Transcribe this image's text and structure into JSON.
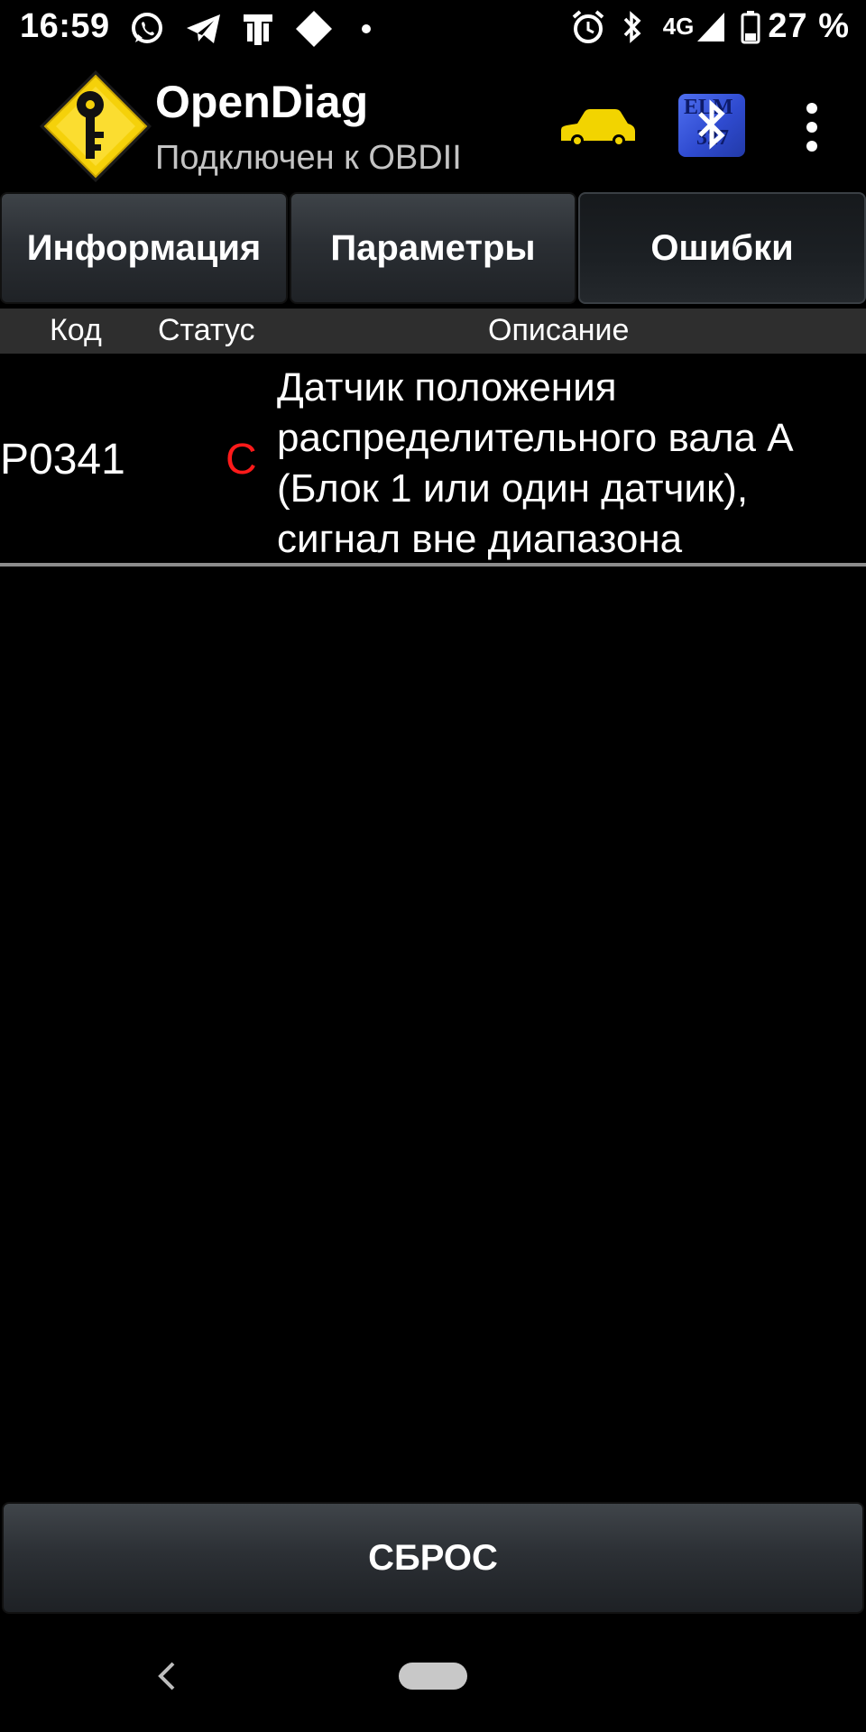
{
  "status_bar": {
    "time": "16:59",
    "network": "4G",
    "battery": "27 %",
    "icons_left": [
      "whatsapp-icon",
      "telegram-icon",
      "game-icon",
      "diamond-icon",
      "dot-icon"
    ],
    "icons_right": [
      "alarm-icon",
      "bluetooth-icon",
      "signal-icon",
      "battery-icon"
    ]
  },
  "app_bar": {
    "title": "OpenDiag",
    "subtitle": "Подключен к OBDII",
    "car_color": "#f2d400",
    "elm_lines": [
      "ELM",
      "327"
    ]
  },
  "tabs": [
    {
      "label": "Информация",
      "active": false
    },
    {
      "label": "Параметры",
      "active": false
    },
    {
      "label": "Ошибки",
      "active": true
    }
  ],
  "table": {
    "headers": {
      "code": "Код",
      "status": "Статус",
      "description": "Описание"
    },
    "rows": [
      {
        "code": "P0341",
        "status": "C",
        "description": "Датчик положения распределительного вала A (Блок 1 или один датчик), сигнал вне диапазона"
      }
    ]
  },
  "reset_button": "СБРОС",
  "colors": {
    "background": "#000000",
    "status_error": "#ff1a1a",
    "header_bg": "#2e2e2e"
  }
}
